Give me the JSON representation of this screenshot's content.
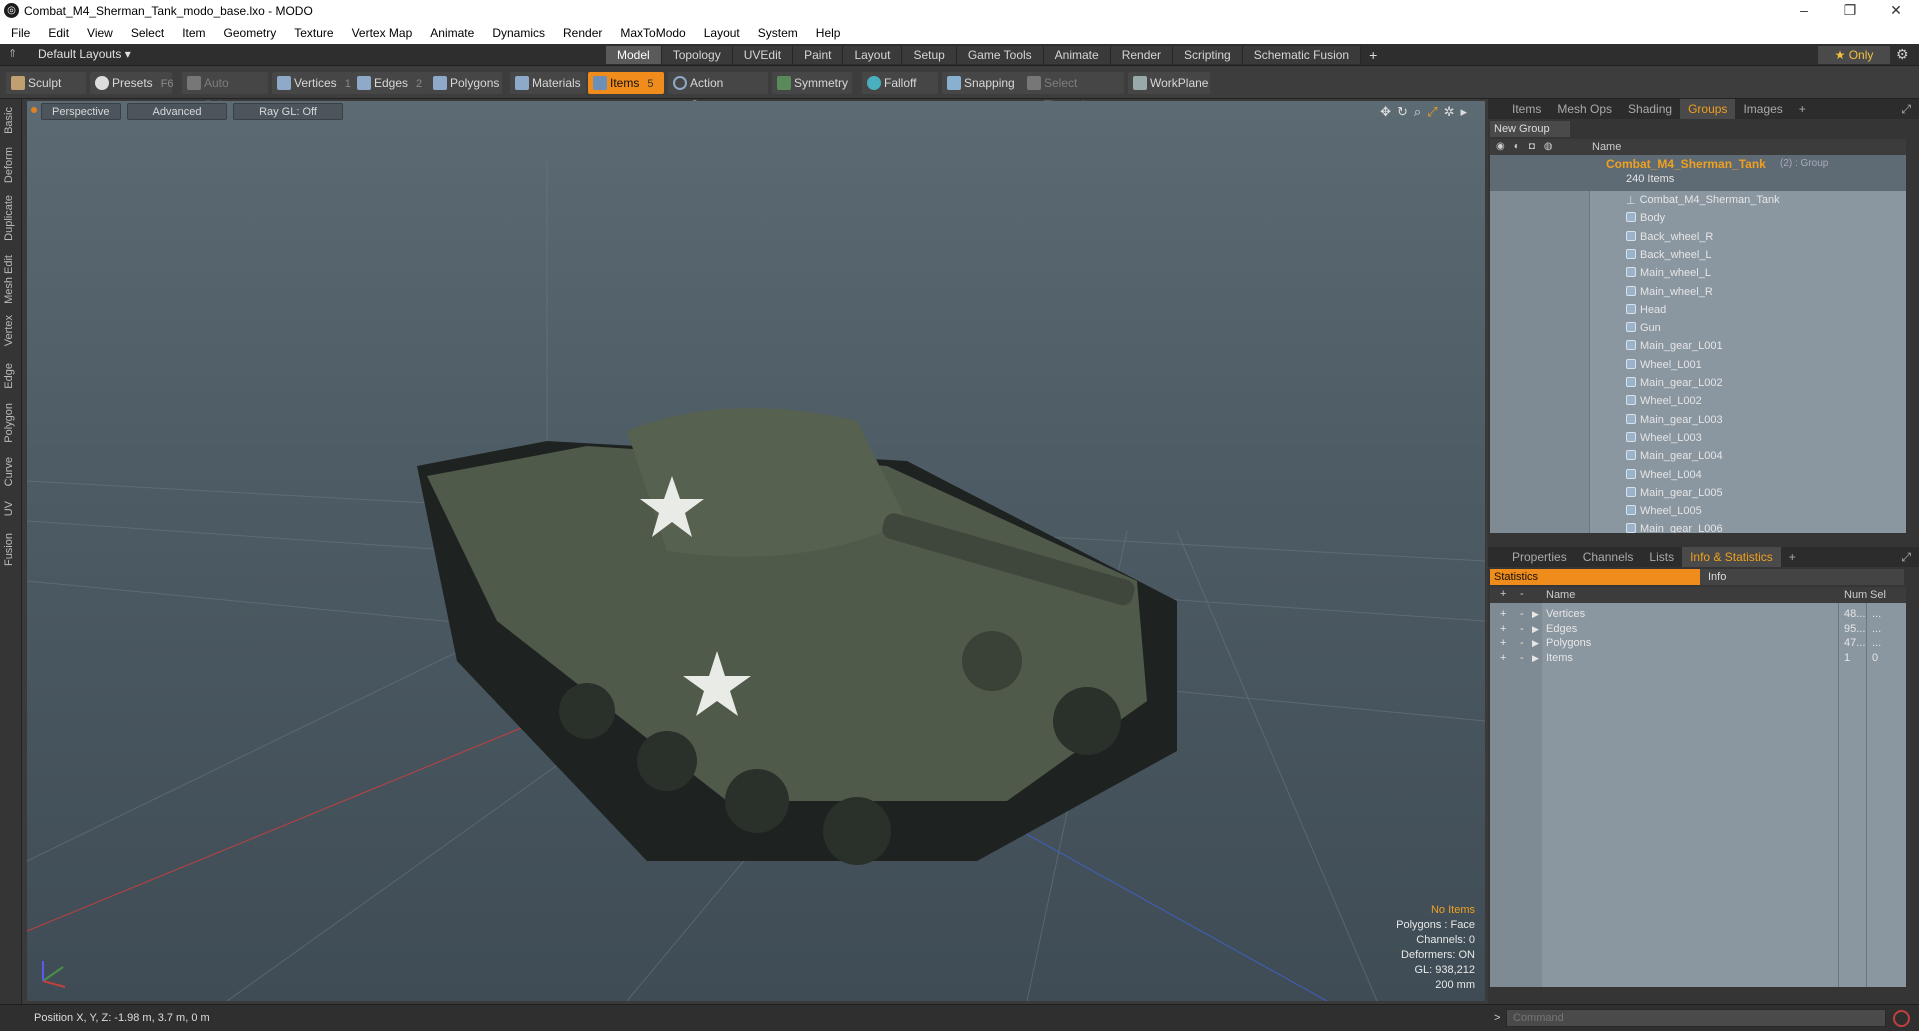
{
  "window": {
    "title": "Combat_M4_Sherman_Tank_modo_base.lxo - MODO",
    "icon": "modo-logo-icon",
    "minimize": "–",
    "maximize": "❐",
    "close": "✕"
  },
  "menu": [
    "File",
    "Edit",
    "View",
    "Select",
    "Item",
    "Geometry",
    "Texture",
    "Vertex Map",
    "Animate",
    "Dynamics",
    "Render",
    "MaxToModo",
    "Layout",
    "System",
    "Help"
  ],
  "layout": {
    "selector": "Default Layouts ▾",
    "tabs": [
      "Model",
      "Topology",
      "UVEdit",
      "Paint",
      "Layout",
      "Setup",
      "Game Tools",
      "Animate",
      "Render",
      "Scripting",
      "Schematic Fusion"
    ],
    "active_tab": "Model",
    "add": "+",
    "only": "★ Only",
    "settings_icon": "gear-icon"
  },
  "toolbar": {
    "sculpt": "Sculpt",
    "presets": "Presets",
    "presets_key": "F6",
    "auto_select": "Auto Select",
    "vertices": "Vertices",
    "vertices_key": "1",
    "edges": "Edges",
    "edges_key": "2",
    "polygons": "Polygons",
    "materials": "Materials",
    "items": "Items",
    "items_key": "5",
    "action_center": "Action Center",
    "symmetry": "Symmetry",
    "falloff": "Falloff",
    "snapping": "Snapping",
    "select_through": "Select Through",
    "workplane": "WorkPlane"
  },
  "left_tabs": [
    "Basic",
    "Deform",
    "Duplicate",
    "Mesh Edit",
    "Vertex",
    "Edge",
    "Polygon",
    "Curve",
    "UV",
    "Fusion"
  ],
  "viewport": {
    "view": "Perspective",
    "shading": "Advanced",
    "raygl": "Ray GL: Off",
    "overlay": [
      "No Items",
      "Polygons : Face",
      "Channels: 0",
      "Deformers: ON",
      "GL: 938,212",
      "200 mm"
    ],
    "colors": {
      "background_top": "#5c6a73",
      "background_bottom": "#3f4c55",
      "tank_body": "#4f5a4b",
      "star": "#e8ebe6"
    }
  },
  "status": {
    "position": "Position X, Y, Z:  -1.98 m, 3.7 m, 0 m",
    "command_placeholder": "Command"
  },
  "items_panel": {
    "tabs": [
      "Items",
      "Mesh Ops",
      "Shading",
      "Groups",
      "Images",
      "+"
    ],
    "active": "Groups",
    "new_group": "New Group",
    "name_col": "Name",
    "group_name": "Combat_M4_Sherman_Tank",
    "group_suffix": "(2) : Group",
    "group_count": "240 Items",
    "items": [
      "Combat_M4_Sherman_Tank",
      "Body",
      "Back_wheel_R",
      "Back_wheel_L",
      "Main_wheel_L",
      "Main_wheel_R",
      "Head",
      "Gun",
      "Main_gear_L001",
      "Wheel_L001",
      "Main_gear_L002",
      "Wheel_L002",
      "Main_gear_L003",
      "Wheel_L003",
      "Main_gear_L004",
      "Wheel_L004",
      "Main_gear_L005",
      "Wheel_L005",
      "Main_gear_L006"
    ]
  },
  "props_panel": {
    "tabs": [
      "Properties",
      "Channels",
      "Lists",
      "Info & Statistics",
      "+"
    ],
    "active": "Info & Statistics",
    "sub_tabs": [
      "Statistics",
      "Info"
    ],
    "header": {
      "name": "Name",
      "num": "Num",
      "sel": "Sel"
    },
    "rows": [
      {
        "name": "Vertices",
        "num": "48...",
        "sel": "..."
      },
      {
        "name": "Edges",
        "num": "95...",
        "sel": "..."
      },
      {
        "name": "Polygons",
        "num": "47...",
        "sel": "..."
      },
      {
        "name": "Items",
        "num": "1",
        "sel": "0"
      }
    ]
  },
  "accent": "#f08c1c"
}
